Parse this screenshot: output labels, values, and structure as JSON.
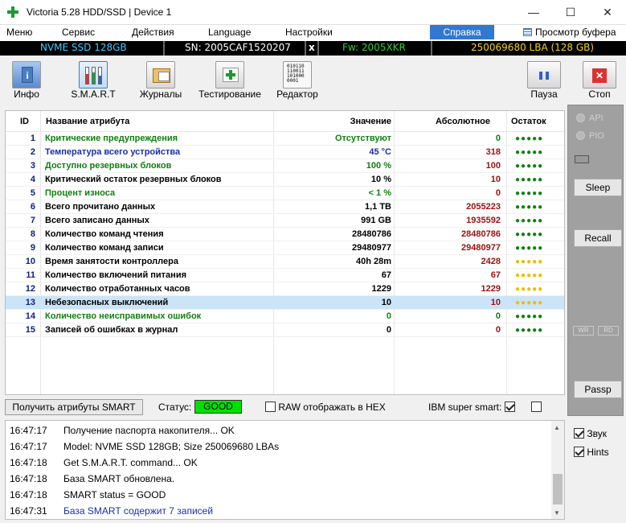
{
  "window": {
    "title": "Victoria 5.28 HDD/SSD | Device 1"
  },
  "menu": {
    "items": [
      "Меню",
      "Сервис",
      "Действия",
      "Language",
      "Настройки"
    ],
    "help": "Справка",
    "buffer_view": "Просмотр буфера"
  },
  "info": {
    "model": "NVME SSD 128GB",
    "serial": "SN: 2005CAF1520207",
    "close": "x",
    "firmware": "Fw: 2005XKR",
    "lba": "250069680 LBA (128 GB)"
  },
  "toolbar": {
    "info": "Инфо",
    "smart": "S.M.A.R.T",
    "journals": "Журналы",
    "testing": "Тестирование",
    "editor": "Редактор",
    "pause": "Пауза",
    "stop": "Стоп"
  },
  "table": {
    "headers": {
      "id": "ID",
      "name": "Название атрибута",
      "value": "Значение",
      "absolute": "Абсолютное",
      "remaining": "Остаток"
    },
    "rows": [
      {
        "id": "1",
        "name": "Критические предупреждения",
        "value": "Отсутствуют",
        "absolute": "0",
        "remaining": "●●●●●",
        "color": "green",
        "vcolor": "green",
        "acolor": "green",
        "rcolor": "green"
      },
      {
        "id": "2",
        "name": "Температура всего устройства",
        "value": "45 °C",
        "absolute": "318",
        "remaining": "●●●●●",
        "color": "blue",
        "vcolor": "blue",
        "acolor": "red",
        "rcolor": "green"
      },
      {
        "id": "3",
        "name": "Доступно резервных блоков",
        "value": "100 %",
        "absolute": "100",
        "remaining": "●●●●●",
        "color": "green",
        "vcolor": "green",
        "acolor": "red",
        "rcolor": "green"
      },
      {
        "id": "4",
        "name": "Критический остаток резервных блоков",
        "value": "10 %",
        "absolute": "10",
        "remaining": "●●●●●",
        "color": "black",
        "vcolor": "black",
        "acolor": "red",
        "rcolor": "green"
      },
      {
        "id": "5",
        "name": "Процент износа",
        "value": "< 1 %",
        "absolute": "0",
        "remaining": "●●●●●",
        "color": "green",
        "vcolor": "green",
        "acolor": "red",
        "rcolor": "green"
      },
      {
        "id": "6",
        "name": "Всего прочитано данных",
        "value": "1,1 TB",
        "absolute": "2055223",
        "remaining": "●●●●●",
        "color": "black",
        "vcolor": "black",
        "acolor": "red",
        "rcolor": "green"
      },
      {
        "id": "7",
        "name": "Всего записано данных",
        "value": "991 GB",
        "absolute": "1935592",
        "remaining": "●●●●●",
        "color": "black",
        "vcolor": "black",
        "acolor": "red",
        "rcolor": "green"
      },
      {
        "id": "8",
        "name": "Количество команд чтения",
        "value": "28480786",
        "absolute": "28480786",
        "remaining": "●●●●●",
        "color": "black",
        "vcolor": "black",
        "acolor": "red",
        "rcolor": "green"
      },
      {
        "id": "9",
        "name": "Количество команд записи",
        "value": "29480977",
        "absolute": "29480977",
        "remaining": "●●●●●",
        "color": "black",
        "vcolor": "black",
        "acolor": "red",
        "rcolor": "green"
      },
      {
        "id": "10",
        "name": "Время занятости контроллера",
        "value": "40h 28m",
        "absolute": "2428",
        "remaining": "●●●●●",
        "color": "black",
        "vcolor": "black",
        "acolor": "red",
        "rcolor": "yellow"
      },
      {
        "id": "11",
        "name": "Количество включений питания",
        "value": "67",
        "absolute": "67",
        "remaining": "●●●●●",
        "color": "black",
        "vcolor": "black",
        "acolor": "red",
        "rcolor": "yellow"
      },
      {
        "id": "12",
        "name": "Количество отработанных часов",
        "value": "1229",
        "absolute": "1229",
        "remaining": "●●●●●",
        "color": "black",
        "vcolor": "black",
        "acolor": "red",
        "rcolor": "yellow"
      },
      {
        "id": "13",
        "name": "Небезопасных выключений",
        "value": "10",
        "absolute": "10",
        "remaining": "●●●●●",
        "color": "black",
        "vcolor": "black",
        "acolor": "red",
        "rcolor": "yellow",
        "selected": true
      },
      {
        "id": "14",
        "name": "Количество неисправимых ошибок",
        "value": "0",
        "absolute": "0",
        "remaining": "●●●●●",
        "color": "green",
        "vcolor": "green",
        "acolor": "green",
        "rcolor": "green"
      },
      {
        "id": "15",
        "name": "Записей об ошибках в журнал",
        "value": "0",
        "absolute": "0",
        "remaining": "●●●●●",
        "color": "black",
        "vcolor": "black",
        "acolor": "red",
        "rcolor": "green"
      }
    ]
  },
  "status": {
    "get_smart": "Получить атрибуты SMART",
    "label": "Статус:",
    "value": "GOOD",
    "raw_hex": "RAW отображать в HEX",
    "ibm": "IBM super smart:"
  },
  "rightpanel": {
    "api": "API",
    "pio": "PIO",
    "sleep": "Sleep",
    "recall": "Recall",
    "passp": "Passp",
    "wr": "WR",
    "rd": "RD"
  },
  "log": [
    {
      "time": "16:47:17",
      "msg": "Получение паспорта накопителя... OK",
      "color": "#000000"
    },
    {
      "time": "16:47:17",
      "msg": "Model: NVME SSD 128GB; Size 250069680 LBAs",
      "color": "#000000"
    },
    {
      "time": "16:47:18",
      "msg": "Get S.M.A.R.T. command... OK",
      "color": "#000000"
    },
    {
      "time": "16:47:18",
      "msg": "База SMART обновлена.",
      "color": "#000000"
    },
    {
      "time": "16:47:18",
      "msg": "SMART status = GOOD",
      "color": "#000000"
    },
    {
      "time": "16:47:31",
      "msg": "База SMART содержит 7 записей",
      "color": "#1a2ea8"
    }
  ],
  "checks": {
    "sound": "Звук",
    "hints": "Hints"
  },
  "colors": {
    "green": "#108010",
    "blue": "#1a2ea8",
    "black": "#000000",
    "red": "#9a1010",
    "yellow": "#e8c000",
    "status_good": "#00e000",
    "help_bg": "#3078d0"
  }
}
